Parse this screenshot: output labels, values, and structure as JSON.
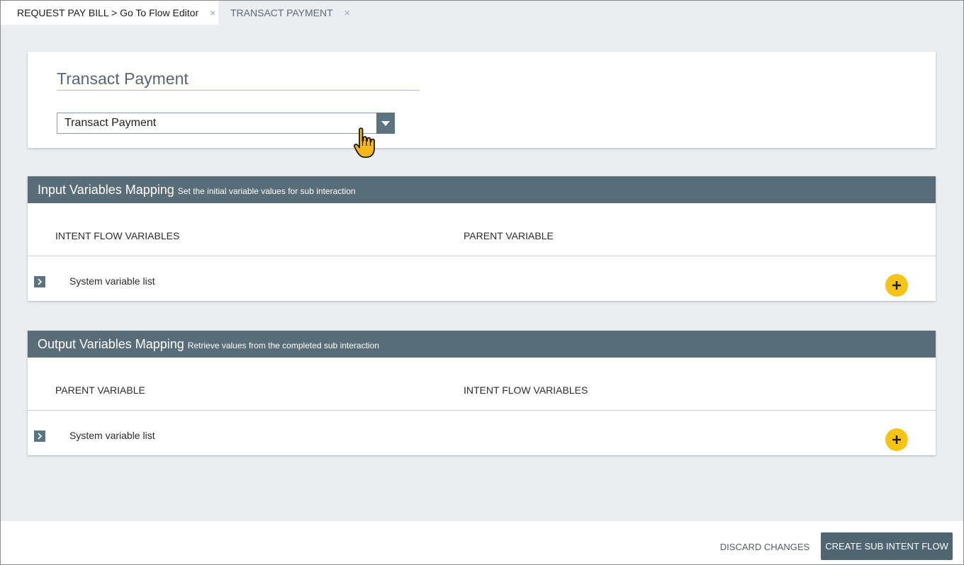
{
  "tabs": [
    {
      "label": "REQUEST PAY BILL > Go To Flow Editor",
      "close": "×"
    },
    {
      "label": "TRANSACT PAYMENT",
      "close": "×"
    }
  ],
  "top_card": {
    "title": "Transact Payment",
    "select_value": "Transact Payment"
  },
  "input_panel": {
    "title": "Input Variables Mapping",
    "subtitle": "Set the initial variable values for sub interaction",
    "col_a": "INTENT FLOW VARIABLES",
    "col_b": "PARENT VARIABLE",
    "row_label": "System variable list"
  },
  "output_panel": {
    "title": "Output Variables Mapping",
    "subtitle": "Retrieve values from the completed sub interaction",
    "col_a": "PARENT VARIABLE",
    "col_b": "INTENT FLOW VARIABLES",
    "row_label": "System variable list"
  },
  "footer": {
    "discard_label": "DISCARD CHANGES",
    "create_label": "CREATE SUB INTENT FLOW"
  },
  "colors": {
    "accent_yellow": "#f6c416",
    "header_slate": "#586d78",
    "button_dark": "#4f6571",
    "background": "#ebeef1"
  },
  "icons": [
    "close-icon",
    "chevron-down-icon",
    "chevron-right-icon",
    "plus-icon",
    "hand-cursor-icon"
  ]
}
